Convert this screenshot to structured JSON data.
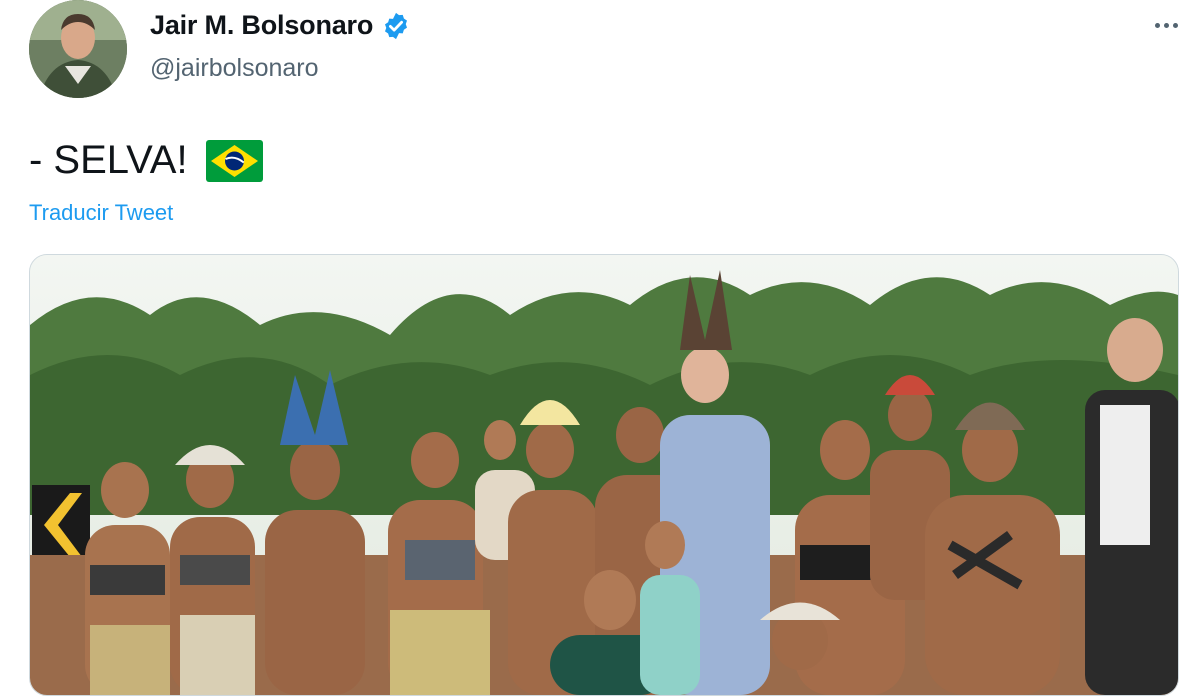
{
  "tweet": {
    "author": {
      "display_name": "Jair M. Bolsonaro",
      "handle": "@jairbolsonaro",
      "verified_icon": "verified-badge-icon",
      "avatar_icon": "profile-avatar"
    },
    "text": "- SELVA!",
    "emoji": "brazil-flag-emoji",
    "translate_label": "Traducir Tweet",
    "more_icon": "more-options-icon",
    "media": {
      "type": "photo"
    }
  },
  "colors": {
    "link_blue": "#1d9bf0",
    "verified_blue": "#1d9bf0",
    "secondary_text": "#536471",
    "primary_text": "#0f1419",
    "flag_green": "#009c3b",
    "flag_yellow": "#ffdf00",
    "flag_blue": "#002776"
  }
}
